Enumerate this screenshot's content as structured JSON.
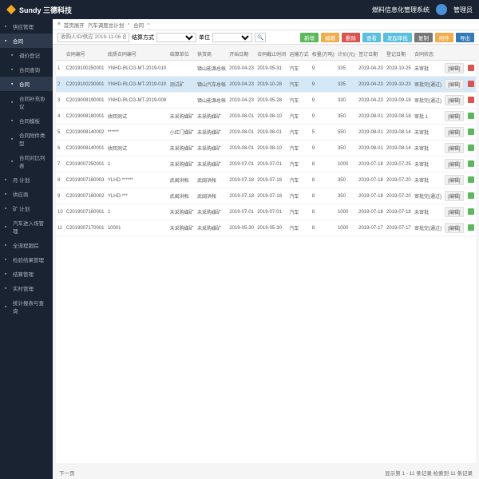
{
  "header": {
    "brand": "Sundy 三德科技",
    "system_name": "燃料信息化管理系统",
    "user": "管理员"
  },
  "sidebar": {
    "items": [
      {
        "label": "供应管理",
        "icon": "list"
      },
      {
        "label": "合同",
        "icon": "doc",
        "active": true
      },
      {
        "label": "调价登记",
        "icon": "edit",
        "indent": true
      },
      {
        "label": "合同查询",
        "icon": "search",
        "indent": true
      },
      {
        "label": "合同",
        "icon": "doc",
        "indent": true,
        "active": true
      },
      {
        "label": "合同补充协议",
        "icon": "doc",
        "indent": true
      },
      {
        "label": "合同模板",
        "icon": "doc",
        "indent": true
      },
      {
        "label": "合同附件类型",
        "icon": "list",
        "indent": true
      },
      {
        "label": "合同对比列表",
        "icon": "list",
        "indent": true
      },
      {
        "label": "月 计划",
        "icon": "cal"
      },
      {
        "label": "供应商",
        "icon": "user"
      },
      {
        "label": "矿 计划",
        "icon": "cal"
      },
      {
        "label": "汽车进入场管理",
        "icon": "truck"
      },
      {
        "label": "全流程跟踪",
        "icon": "flow"
      },
      {
        "label": "检验结果管理",
        "icon": "check"
      },
      {
        "label": "结算管理",
        "icon": "money"
      },
      {
        "label": "实时管理",
        "icon": "time"
      },
      {
        "label": "统计报表与查询",
        "icon": "chart"
      }
    ]
  },
  "breadcrumb": {
    "items": [
      "首页展开",
      "汽车调度总计划",
      "合同"
    ]
  },
  "toolbar": {
    "search_placeholder": "收购人ID/供应 2019-11-06 合同状态",
    "filter1_label": "结算方式",
    "filter2_label": "单位",
    "btn_add": "新增",
    "btn_edit": "编辑",
    "btn_del": "删除",
    "btn_view": "查看",
    "btn_send": "发起审批",
    "btn_copy": "复制",
    "btn_attach": "附件",
    "btn_export": "导出"
  },
  "table": {
    "headers": [
      "",
      "合同编号",
      "底质合同编号",
      "结算单位",
      "供货商",
      "开始日期",
      "合同截止时间",
      "运输方式",
      "权量(万吨)",
      "计价(元)",
      "签订日期",
      "登记日期",
      "合同状态",
      " ",
      " "
    ],
    "rows": [
      {
        "n": "1",
        "code": "C2019100250001",
        "bottom": "YNHD-RLCG-MT-2019-010",
        "unit": "",
        "supplier": "镇山能源总帐",
        "start": "2019-04-23",
        "end": "2019-05-31",
        "trans": "汽车",
        "qty": "9",
        "price": "335",
        "sign": "2019-04-23",
        "reg": "2019-10-25",
        "status": "未审批",
        "act": "[编辑]",
        "flag": "red"
      },
      {
        "n": "2",
        "code": "C2019100230001",
        "bottom": "YNHD-RLCG-MT-2019-010",
        "unit": "测试矿",
        "supplier": "镇山汽车总帐",
        "start": "2019-04-23",
        "end": "2019-10-28",
        "trans": "汽车",
        "qty": "9",
        "price": "335",
        "sign": "2019-04-23",
        "reg": "2019-10-23",
        "status": "审批完(通过)",
        "act": "[编辑]",
        "flag": "red",
        "selected": true
      },
      {
        "n": "3",
        "code": "C2019008190001",
        "bottom": "YNHD-RLCG-MT-2019-009",
        "unit": "",
        "supplier": "镇山能源总帐",
        "start": "2019-04-23",
        "end": "2019-05-28",
        "trans": "汽车",
        "qty": "9",
        "price": "330",
        "sign": "2019-04-23",
        "reg": "2019-09-19",
        "status": "审批完(通过)",
        "act": "[编辑]",
        "flag": "red"
      },
      {
        "n": "4",
        "code": "C2019008180001",
        "bottom": "收回测试",
        "unit": "未采购媒矿",
        "supplier": "未采购媒矿",
        "start": "2019-08-01",
        "end": "2019-08-10",
        "trans": "汽车",
        "qty": "9",
        "price": "350",
        "sign": "2019-08-01",
        "reg": "2019-08-18",
        "status": "审批 1",
        "act": "[编辑]",
        "flag": "green"
      },
      {
        "n": "5",
        "code": "C2019008140002",
        "bottom": "******",
        "unit": "小红门媒矿",
        "supplier": "未采购媒矿",
        "start": "2019-08-01",
        "end": "2019-08-01",
        "trans": "汽车",
        "qty": "5",
        "price": "550",
        "sign": "2019-08-01",
        "reg": "2019-08-14",
        "status": "未审批",
        "act": "[编辑]",
        "flag": "green"
      },
      {
        "n": "6",
        "code": "C2019008140001",
        "bottom": "收回测试",
        "unit": "未采购媒矿",
        "supplier": "未采购媒矿",
        "start": "2019-08-01",
        "end": "2019-08-10",
        "trans": "汽车",
        "qty": "9",
        "price": "350",
        "sign": "2019-08-01",
        "reg": "2019-08-14",
        "status": "未审批",
        "act": "[编辑]",
        "flag": "green"
      },
      {
        "n": "7",
        "code": "C2019007250001",
        "bottom": "1",
        "unit": "未采购媒矿",
        "supplier": "未采购媒矿",
        "start": "2019-07-01",
        "end": "2019-07-01",
        "trans": "汽车",
        "qty": "8",
        "price": "1000",
        "sign": "2019-07-18",
        "reg": "2019-07-25",
        "status": "未审批",
        "act": "[编辑]",
        "flag": "green"
      },
      {
        "n": "8",
        "code": "C2019007180003",
        "bottom": "YLHD-******",
        "unit": "武闽洪帐",
        "supplier": "武闽洪帐",
        "start": "2019-07-18",
        "end": "2019-07-18",
        "trans": "汽车",
        "qty": "8",
        "price": "350",
        "sign": "2019-07-18",
        "reg": "2019-07-20",
        "status": "未审批",
        "act": "[编辑]",
        "flag": "green"
      },
      {
        "n": "9",
        "code": "C2019007180002",
        "bottom": "YLHD-***",
        "unit": "武闽洪帐",
        "supplier": "武闽洪帐",
        "start": "2019-07-18",
        "end": "2019-07-18",
        "trans": "汽车",
        "qty": "8",
        "price": "350",
        "sign": "2019-07-18",
        "reg": "2019-07-20",
        "status": "审批完(通过)",
        "act": "[编辑]",
        "flag": "green"
      },
      {
        "n": "10",
        "code": "C2019007180001",
        "bottom": "1",
        "unit": "未采购媒矿",
        "supplier": "未采购媒矿",
        "start": "2019-07-01",
        "end": "2019-07-01",
        "trans": "汽车",
        "qty": "8",
        "price": "1000",
        "sign": "2019-07-18",
        "reg": "2019-07-18",
        "status": "未审批",
        "act": "[编辑]",
        "flag": "green"
      },
      {
        "n": "11",
        "code": "C2019007170001",
        "bottom": "10001",
        "unit": "未采购媒矿",
        "supplier": "未采购媒矿",
        "start": "2019-05-30",
        "end": "2019-05-30",
        "trans": "汽车",
        "qty": "8",
        "price": "1000",
        "sign": "2019-07-17",
        "reg": "2019-07-17",
        "status": "审批完(通过)",
        "act": "[编辑]",
        "flag": "green"
      }
    ]
  },
  "pagination": {
    "left": "下一页",
    "right": "显示第 1 - 11 条记录  检索到 11 条记录"
  }
}
